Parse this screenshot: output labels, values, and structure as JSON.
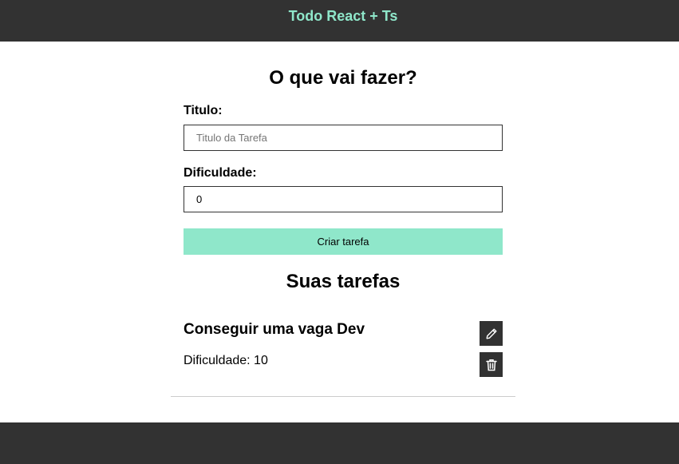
{
  "header": {
    "title": "Todo React + Ts"
  },
  "form": {
    "title": "O que vai fazer?",
    "title_label": "Titulo:",
    "title_placeholder": "Titulo da Tarefa",
    "title_value": "",
    "difficulty_label": "Dificuldade:",
    "difficulty_value": "0",
    "submit_label": "Criar tarefa"
  },
  "tasks": {
    "heading": "Suas tarefas",
    "items": [
      {
        "title": "Conseguir uma vaga Dev",
        "difficulty_text": "Dificuldade: 10",
        "edit_icon": "pencil-icon",
        "delete_icon": "trash-icon"
      }
    ]
  },
  "colors": {
    "dark": "#323232",
    "accent": "#8fe7ca",
    "divider": "#cccccc"
  }
}
